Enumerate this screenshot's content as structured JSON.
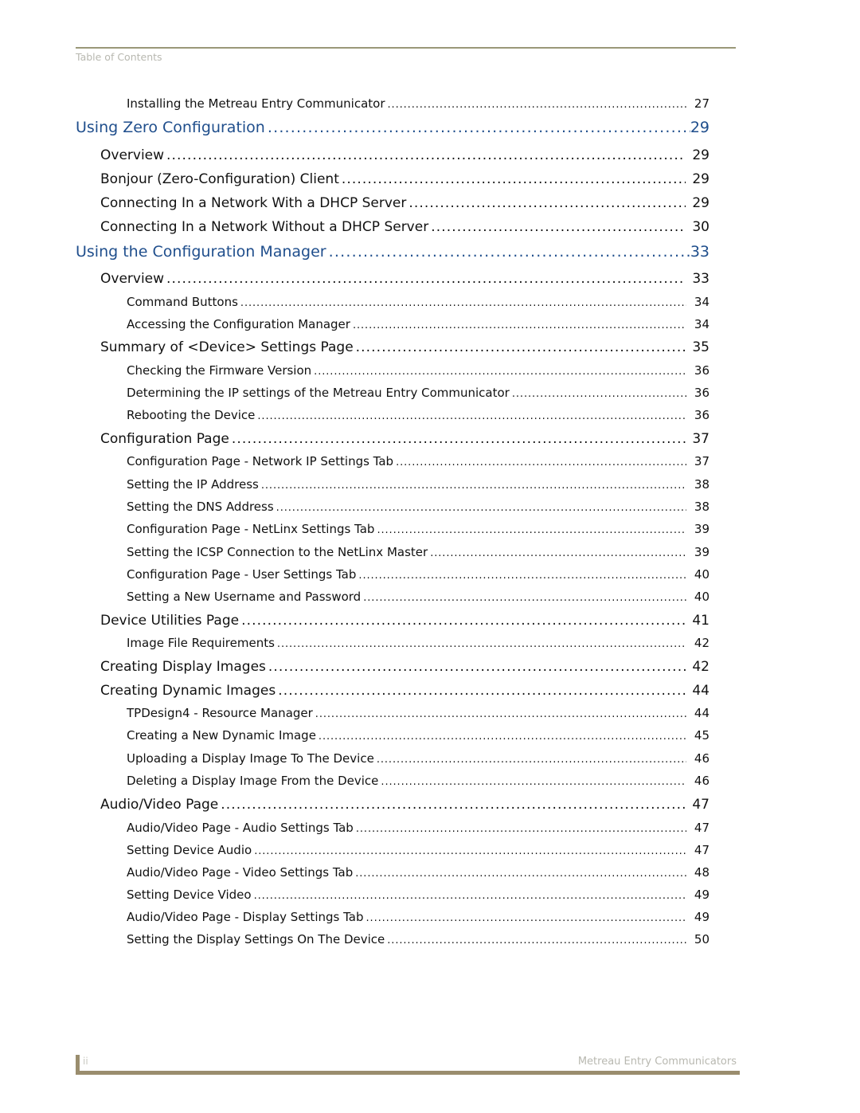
{
  "header": {
    "running_head": "Table of Contents"
  },
  "toc": [
    {
      "level": 2,
      "title": "Installing the Metreau Entry Communicator",
      "page": "27"
    },
    {
      "level": 0,
      "title": "Using Zero Configuration",
      "page": "29"
    },
    {
      "level": 1,
      "title": "Overview",
      "page": "29"
    },
    {
      "level": 1,
      "title": "Bonjour (Zero-Configuration) Client",
      "page": "29"
    },
    {
      "level": 1,
      "title": "Connecting In a Network With a DHCP Server",
      "page": "29"
    },
    {
      "level": 1,
      "title": "Connecting In a Network Without a DHCP Server",
      "page": "30"
    },
    {
      "level": 0,
      "title": "Using the Configuration Manager",
      "page": "33"
    },
    {
      "level": 1,
      "title": "Overview",
      "page": "33"
    },
    {
      "level": 2,
      "title": "Command Buttons",
      "page": "34"
    },
    {
      "level": 2,
      "title": "Accessing the Configuration Manager",
      "page": "34"
    },
    {
      "level": 1,
      "title": "Summary of <Device> Settings Page",
      "page": "35"
    },
    {
      "level": 2,
      "title": "Checking the Firmware Version",
      "page": "36"
    },
    {
      "level": 2,
      "title": "Determining the IP settings of the Metreau Entry Communicator",
      "page": "36"
    },
    {
      "level": 2,
      "title": "Rebooting the Device",
      "page": "36"
    },
    {
      "level": 1,
      "title": "Configuration Page",
      "page": "37"
    },
    {
      "level": 2,
      "title": "Configuration Page - Network IP Settings Tab",
      "page": "37"
    },
    {
      "level": 2,
      "title": "Setting the IP Address",
      "page": "38"
    },
    {
      "level": 2,
      "title": "Setting the DNS Address",
      "page": "38"
    },
    {
      "level": 2,
      "title": "Configuration Page - NetLinx Settings Tab",
      "page": "39"
    },
    {
      "level": 2,
      "title": "Setting the ICSP Connection to the NetLinx Master",
      "page": "39"
    },
    {
      "level": 2,
      "title": "Configuration Page - User Settings Tab",
      "page": "40"
    },
    {
      "level": 2,
      "title": "Setting a New Username and Password",
      "page": "40"
    },
    {
      "level": 1,
      "title": "Device Utilities Page",
      "page": "41"
    },
    {
      "level": 2,
      "title": "Image File Requirements",
      "page": "42"
    },
    {
      "level": 1,
      "title": "Creating Display Images",
      "page": "42"
    },
    {
      "level": 1,
      "title": "Creating Dynamic Images",
      "page": "44"
    },
    {
      "level": 2,
      "title": "TPDesign4 - Resource Manager",
      "page": "44"
    },
    {
      "level": 2,
      "title": "Creating a New Dynamic Image",
      "page": "45"
    },
    {
      "level": 2,
      "title": "Uploading a Display Image To The Device",
      "page": "46"
    },
    {
      "level": 2,
      "title": "Deleting a Display Image From the Device",
      "page": "46"
    },
    {
      "level": 1,
      "title": "Audio/Video Page",
      "page": "47"
    },
    {
      "level": 2,
      "title": "Audio/Video Page - Audio Settings Tab",
      "page": "47"
    },
    {
      "level": 2,
      "title": "Setting Device Audio",
      "page": "47"
    },
    {
      "level": 2,
      "title": "Audio/Video Page - Video Settings Tab",
      "page": "48"
    },
    {
      "level": 2,
      "title": "Setting Device Video",
      "page": "49"
    },
    {
      "level": 2,
      "title": "Audio/Video Page - Display Settings Tab",
      "page": "49"
    },
    {
      "level": 2,
      "title": "Setting the Display Settings On The Device",
      "page": "50"
    }
  ],
  "footer": {
    "page_number": "ii",
    "document_title": "Metreau Entry Communicators"
  },
  "colors": {
    "chapter_blue": "#1f4e8c",
    "rule_olive": "#9a9878",
    "footer_bar": "#9a8d6e"
  }
}
